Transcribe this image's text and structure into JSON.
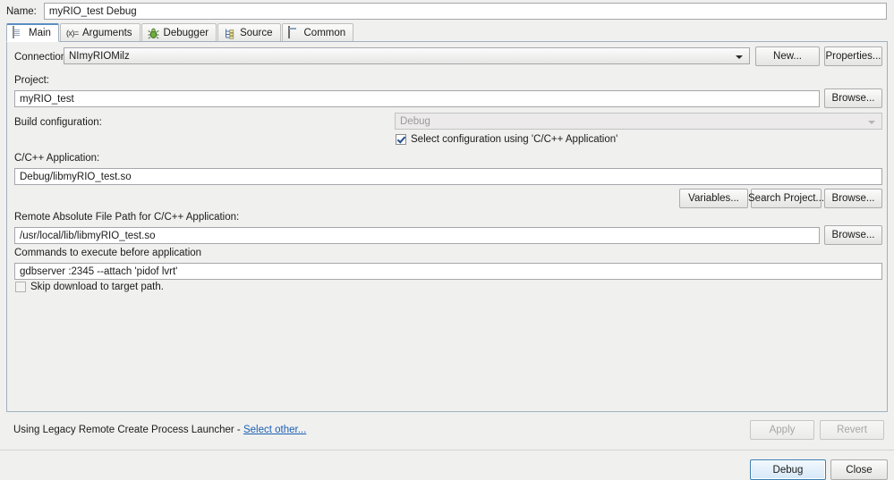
{
  "dialog": {
    "name_label": "Name:",
    "name_value": "myRIO_test Debug"
  },
  "tabs": [
    {
      "label": "Main",
      "icon": "document-icon",
      "selected": true
    },
    {
      "label": "Arguments",
      "icon": "arguments-icon",
      "selected": false
    },
    {
      "label": "Debugger",
      "icon": "bug-icon",
      "selected": false
    },
    {
      "label": "Source",
      "icon": "source-tree-icon",
      "selected": false
    },
    {
      "label": "Common",
      "icon": "window-icon",
      "selected": false
    }
  ],
  "main": {
    "connection_label": "Connection:",
    "connection_value": "NImyRIOMilz",
    "new_button": "New...",
    "properties_button": "Properties...",
    "project_label": "Project:",
    "project_value": "myRIO_test",
    "project_browse_button": "Browse...",
    "build_config_label": "Build configuration:",
    "build_config_value": "Debug",
    "select_config_checkbox_label": "Select configuration using 'C/C++ Application'",
    "select_config_checked": true,
    "cpp_app_label": "C/C++ Application:",
    "cpp_app_value": "Debug/libmyRIO_test.so",
    "variables_button": "Variables...",
    "search_project_button": "Search Project...",
    "cpp_browse_button": "Browse...",
    "remote_path_label": "Remote Absolute File Path for C/C++ Application:",
    "remote_path_value": "/usr/local/lib/libmyRIO_test.so",
    "remote_browse_button": "Browse...",
    "commands_label": "Commands to execute before application",
    "commands_value": "gdbserver :2345 --attach 'pidof lvrt'",
    "skip_download_label": "Skip download to target path.",
    "skip_download_checked": false
  },
  "status": {
    "launcher_text": "Using Legacy Remote Create Process Launcher - ",
    "select_other_link": "Select other...",
    "apply_button": "Apply",
    "revert_button": "Revert"
  },
  "footer": {
    "debug_button": "Debug",
    "close_button": "Close"
  },
  "colors": {
    "link": "#1a5fb4",
    "default_button_border": "#3c7fb1",
    "tab_selected_top": "#5b8ec4",
    "background": "#f0f0ef"
  }
}
